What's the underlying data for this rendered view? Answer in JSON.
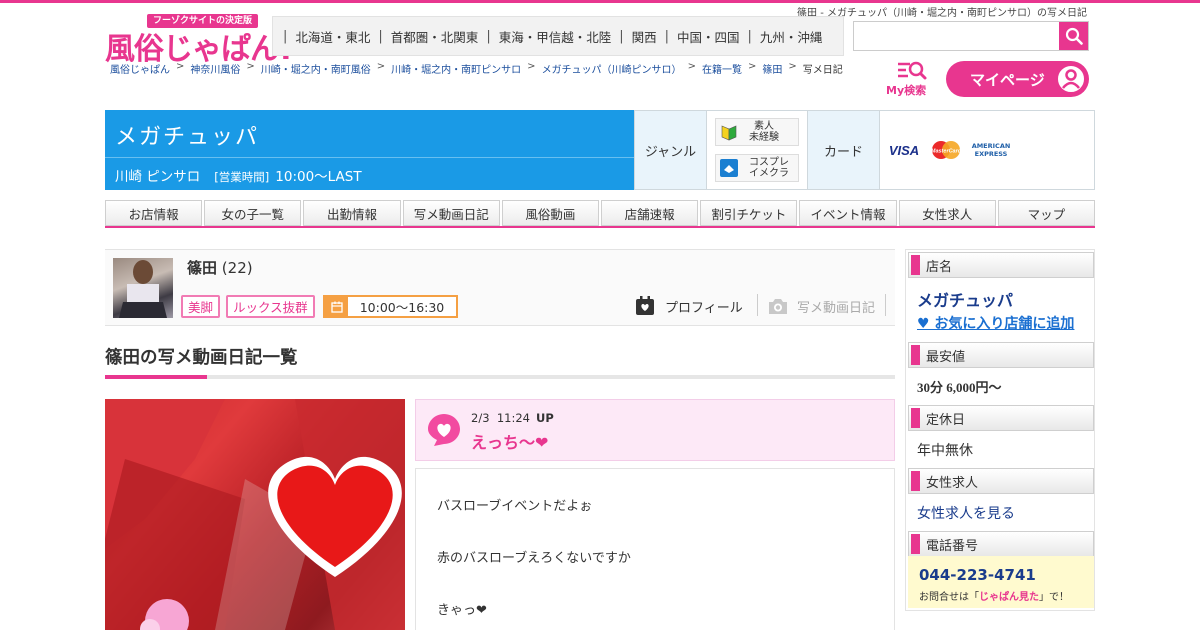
{
  "page_caption": "篠田 - メガチュッパ（川崎・堀之内・南町ピンサロ）の写メ日記",
  "logo": {
    "tagline": "フーゾクサイトの決定版",
    "name": "風俗じゃぱん!"
  },
  "region_nav": [
    "北海道・東北",
    "首都圏・北関東",
    "東海・甲信越・北陸",
    "関西",
    "中国・四国",
    "九州・沖縄"
  ],
  "search": {
    "value": "",
    "placeholder": ""
  },
  "breadcrumb": [
    "風俗じゃぱん",
    "神奈川風俗",
    "川崎・堀之内・南町風俗",
    "川崎・堀之内・南町ピンサロ",
    "メガチュッパ（川崎ピンサロ）",
    "在籍一覧",
    "篠田",
    "写メ日記"
  ],
  "my_search_label": "My検索",
  "mypage_label": "マイページ",
  "shop": {
    "name": "メガチュッパ",
    "area_genre": "川崎 ピンサロ",
    "hours_label": "[営業時間]",
    "hours": "10:00～LAST"
  },
  "attributes": {
    "genre_label": "ジャンル",
    "genres": [
      "素人未経験",
      "コスプレイメクラ"
    ],
    "genre_lines": [
      [
        "素人",
        "未経験"
      ],
      [
        "コスプレ",
        "イメクラ"
      ]
    ],
    "card_label": "カード",
    "cards": [
      "VISA",
      "MasterCard",
      "AMERICAN EXPRESS"
    ]
  },
  "tabs": [
    "お店情報",
    "女の子一覧",
    "出勤情報",
    "写メ動画日記",
    "風俗動画",
    "店舗速報",
    "割引チケット",
    "イベント情報",
    "女性求人",
    "マップ"
  ],
  "girl": {
    "name": "篠田",
    "age": "(22)",
    "tags": [
      "美脚",
      "ルックス抜群"
    ],
    "schedule": "10:00～16:30",
    "profile_link": "プロフィール",
    "diary_link": "写メ動画日記"
  },
  "section_title": "篠田の写メ動画日記一覧",
  "diary": {
    "date": "2/3",
    "time": "11:24",
    "up": "UP",
    "title": "えっち〜❤",
    "lines": [
      "バスローブイベントだよぉ",
      "赤のバスローブえろくないですか",
      "きゃっ❤"
    ]
  },
  "sidebar": {
    "shop_label": "店名",
    "shop_name": "メガチュッパ",
    "favorite": "♥ お気に入り店舗に追加",
    "price_label": "最安値",
    "price": "30分 6,000円～",
    "holiday_label": "定休日",
    "holiday": "年中無休",
    "recruit_label": "女性求人",
    "recruit_link": "女性求人を見る",
    "phone_label": "電話番号",
    "phone": "044-223-4741",
    "phone_note_pre": "お問合せは「",
    "phone_note_accent": "じゃぱん見た",
    "phone_note_post": "」で！"
  },
  "colors": {
    "accent": "#e8368f",
    "brand_blue": "#1a9ae6",
    "link": "#1a4d9c",
    "schedule": "#f5a043",
    "diary_bg": "#fde9f7",
    "phone_bg": "#fffacf"
  }
}
